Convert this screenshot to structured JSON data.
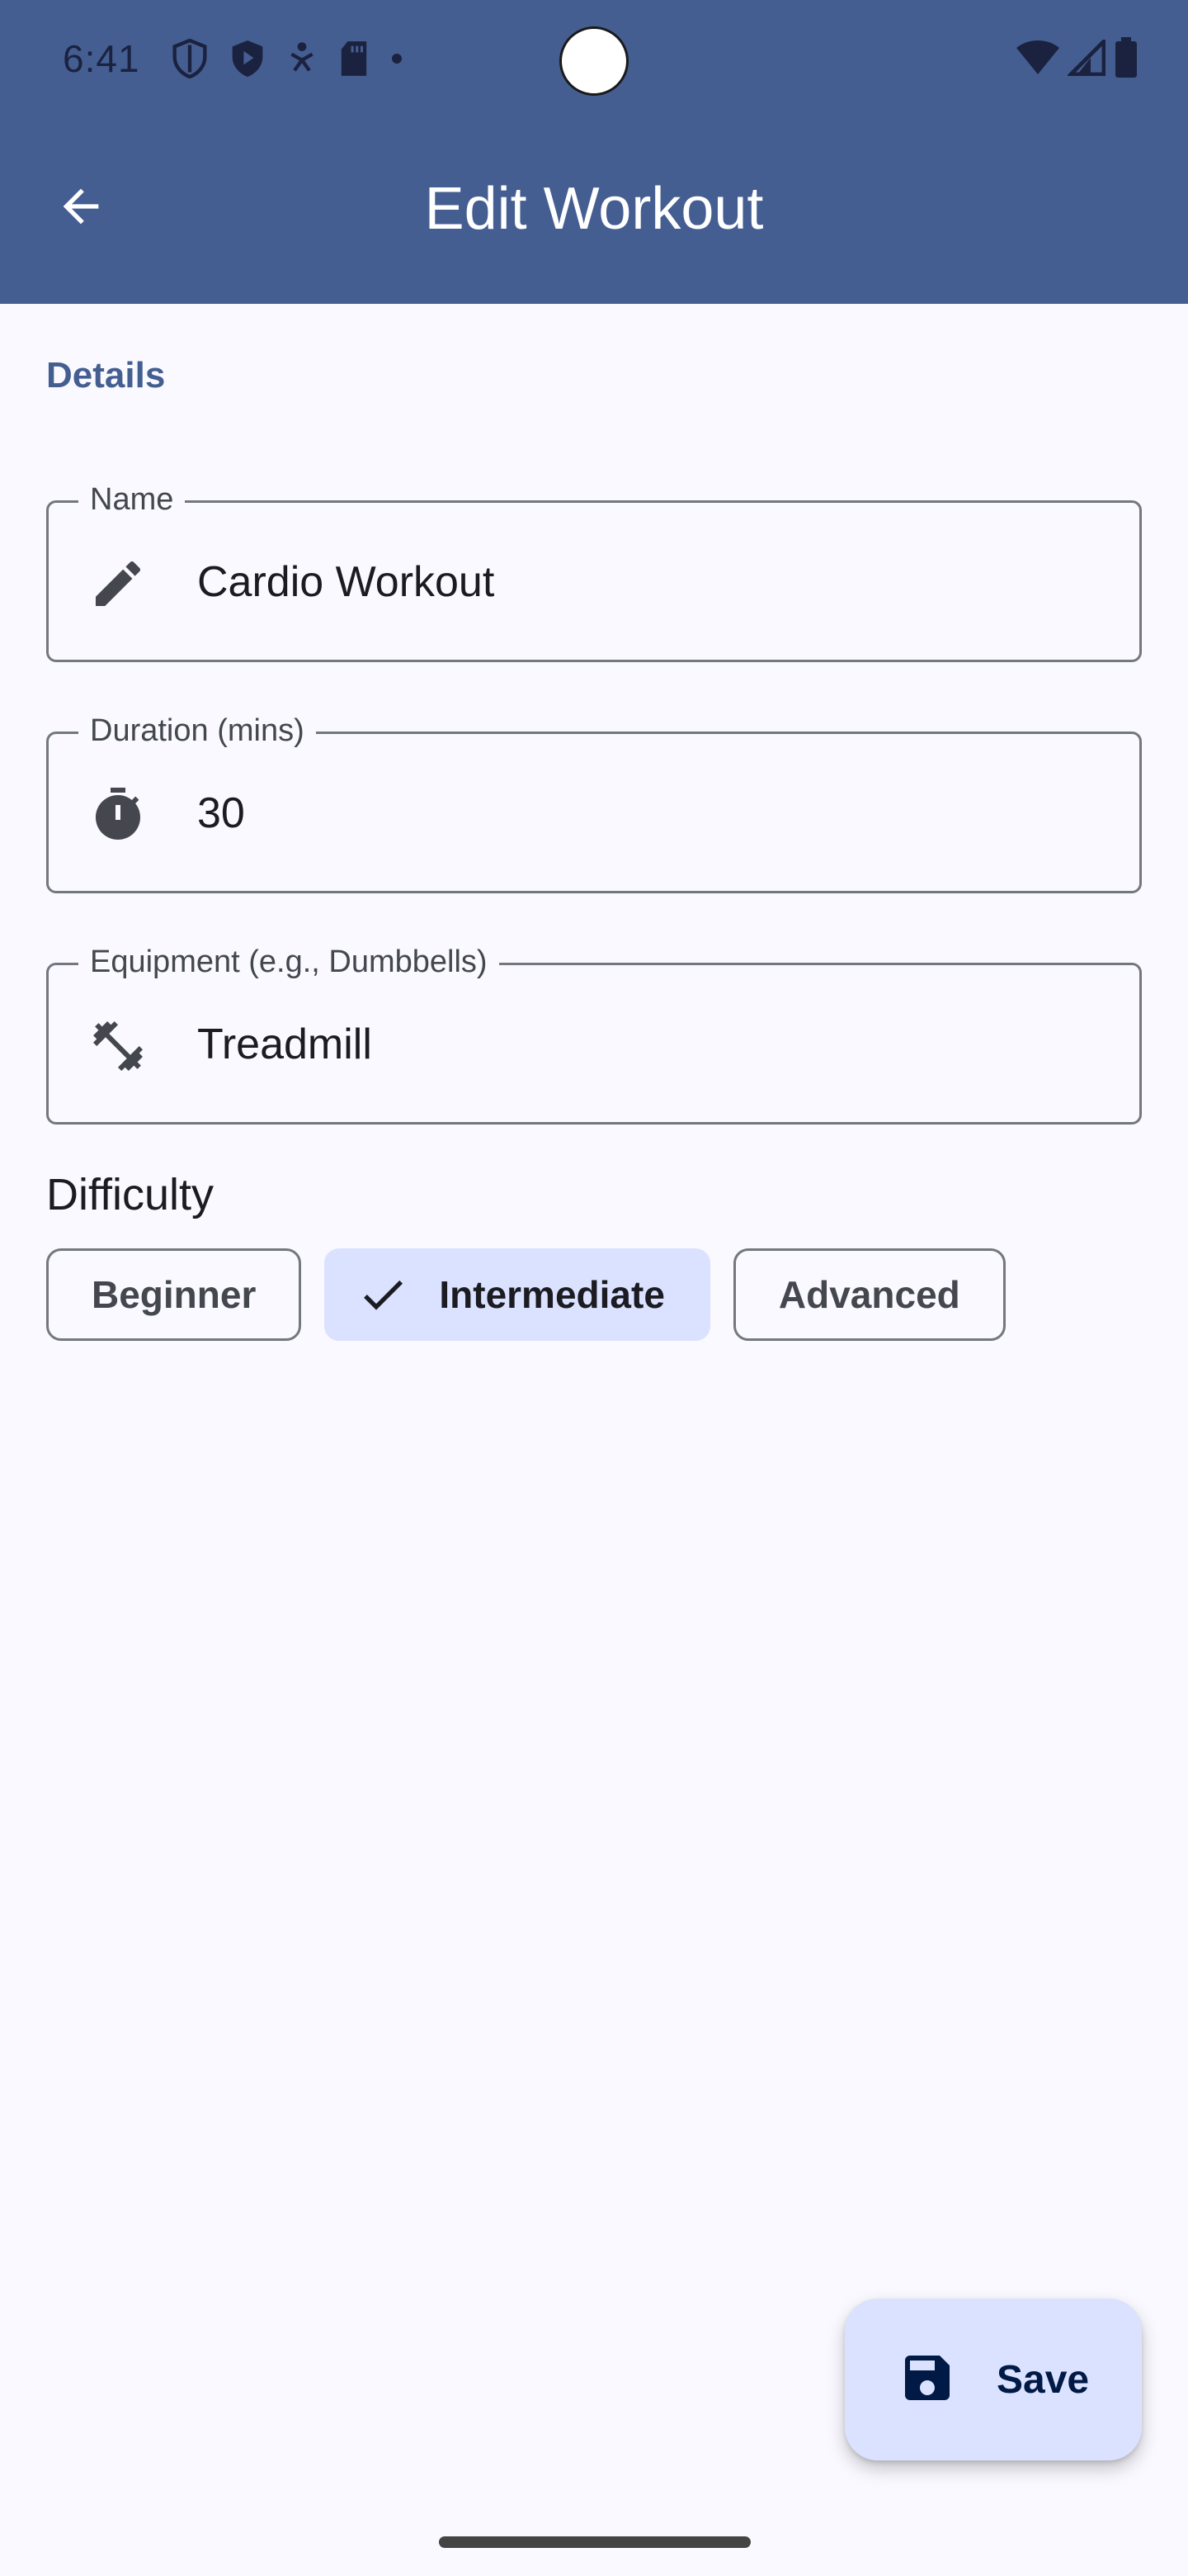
{
  "status_bar": {
    "time": "6:41",
    "left_icons": [
      "shield-outline-icon",
      "shield-play-icon",
      "accessibility-icon",
      "sd-card-icon",
      "dot-icon"
    ],
    "right_icons": [
      "wifi-icon",
      "signal-icon",
      "battery-icon"
    ]
  },
  "app_bar": {
    "title": "Edit Workout",
    "back_icon": "arrow-back-icon"
  },
  "details": {
    "section_label": "Details",
    "fields": [
      {
        "label": "Name",
        "value": "Cardio Workout",
        "icon": "edit-pencil-icon"
      },
      {
        "label": "Duration (mins)",
        "value": "30",
        "icon": "timer-icon"
      },
      {
        "label": "Equipment (e.g., Dumbbells)",
        "value": "Treadmill",
        "icon": "fitness-dumbbell-icon"
      }
    ]
  },
  "difficulty": {
    "label": "Difficulty",
    "options": [
      {
        "label": "Beginner",
        "selected": false
      },
      {
        "label": "Intermediate",
        "selected": true
      },
      {
        "label": "Advanced",
        "selected": false
      }
    ]
  },
  "fab": {
    "label": "Save",
    "icon": "save-icon"
  },
  "colors": {
    "primary": "#455E91",
    "background": "#F9F9FF",
    "chip_selected": "#DAE2FF",
    "outline": "#74777F",
    "fab_container": "#DAE2FF"
  }
}
